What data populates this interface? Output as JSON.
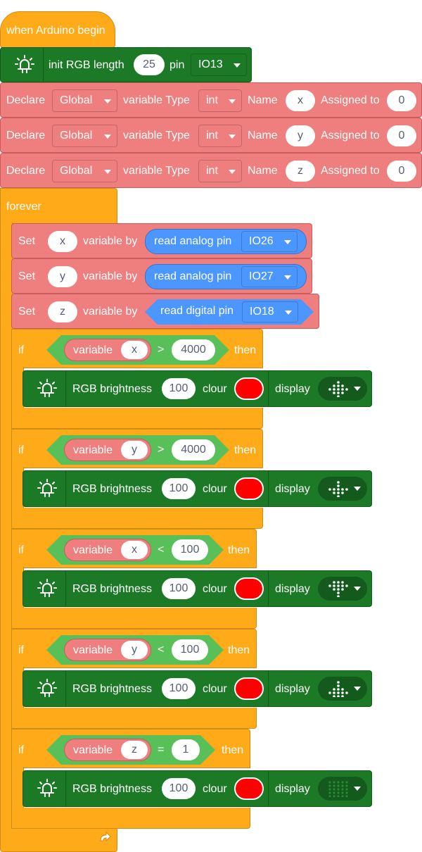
{
  "hat": {
    "label": "when Arduino begin"
  },
  "init": {
    "label": "init RGB length",
    "length": "25",
    "pin_label": "pin",
    "pin": "IO13"
  },
  "declares": [
    {
      "label": "Declare",
      "scope": "Global",
      "type_label": "variable Type",
      "type": "int",
      "name_label": "Name",
      "name": "x",
      "assign_label": "Assigned to",
      "value": "0"
    },
    {
      "label": "Declare",
      "scope": "Global",
      "type_label": "variable Type",
      "type": "int",
      "name_label": "Name",
      "name": "y",
      "assign_label": "Assigned to",
      "value": "0"
    },
    {
      "label": "Declare",
      "scope": "Global",
      "type_label": "variable Type",
      "type": "int",
      "name_label": "Name",
      "name": "z",
      "assign_label": "Assigned to",
      "value": "0"
    }
  ],
  "forever": {
    "label": "forever"
  },
  "sets": [
    {
      "label": "Set",
      "var": "x",
      "by_label": "variable by",
      "reporter": "read analog pin",
      "pin": "IO26"
    },
    {
      "label": "Set",
      "var": "y",
      "by_label": "variable by",
      "reporter": "read analog pin",
      "pin": "IO27"
    },
    {
      "label": "Set",
      "var": "z",
      "by_label": "variable by",
      "reporter": "read digital pin",
      "pin": "IO18"
    }
  ],
  "ifs": [
    {
      "if_label": "if",
      "var_label": "variable",
      "var": "x",
      "op": ">",
      "value": "4000",
      "then_label": "then",
      "rgb": {
        "label": "RGB brightness",
        "brightness": "100",
        "colour_label": "clour",
        "display_label": "display",
        "colour": "#ff0000"
      }
    },
    {
      "if_label": "if",
      "var_label": "variable",
      "var": "y",
      "op": ">",
      "value": "4000",
      "then_label": "then",
      "rgb": {
        "label": "RGB brightness",
        "brightness": "100",
        "colour_label": "clour",
        "display_label": "display",
        "colour": "#ff0000"
      }
    },
    {
      "if_label": "if",
      "var_label": "variable",
      "var": "x",
      "op": "<",
      "value": "100",
      "then_label": "then",
      "rgb": {
        "label": "RGB brightness",
        "brightness": "100",
        "colour_label": "clour",
        "display_label": "display",
        "colour": "#ff0000"
      }
    },
    {
      "if_label": "if",
      "var_label": "variable",
      "var": "y",
      "op": "<",
      "value": "100",
      "then_label": "then",
      "rgb": {
        "label": "RGB brightness",
        "brightness": "100",
        "colour_label": "clour",
        "display_label": "display",
        "colour": "#ff0000"
      }
    },
    {
      "if_label": "if",
      "var_label": "variable",
      "var": "z",
      "op": "=",
      "value": "1",
      "then_label": "then",
      "rgb": {
        "label": "RGB brightness",
        "brightness": "100",
        "colour_label": "clour",
        "display_label": "display",
        "colour": "#ff0000"
      }
    }
  ],
  "colors": {
    "events": "#ffab19",
    "variables": "#ef7e7e",
    "rgb": "#1c7a27",
    "sensing": "#4c97ff",
    "operators": "#59c059"
  }
}
